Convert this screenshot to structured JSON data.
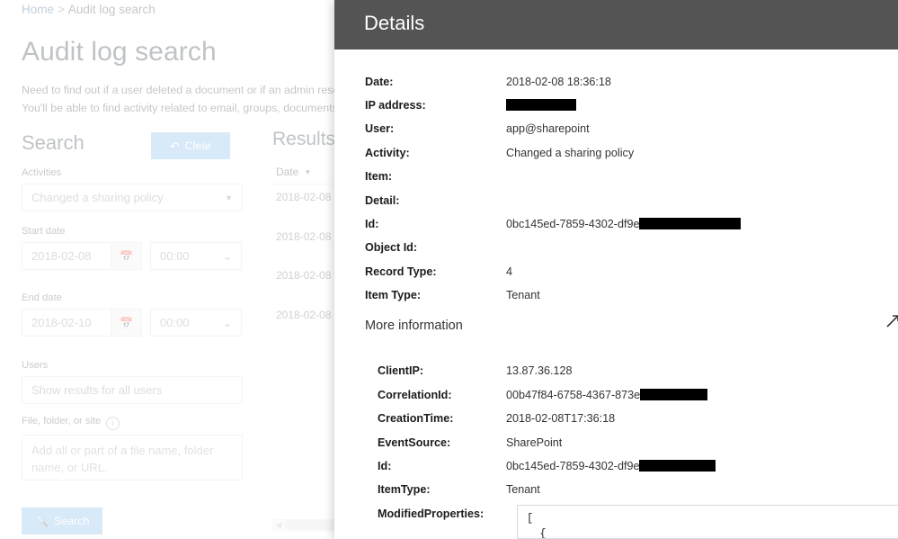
{
  "breadcrumb": {
    "home": "Home",
    "separator": ">",
    "current": "Audit log search"
  },
  "page": {
    "title": "Audit log search",
    "description_line1": "Need to find out if a user deleted a document or if an admin reset s",
    "description_line2": "You'll be able to find activity related to email, groups, documents, ("
  },
  "search_panel": {
    "heading": "Search",
    "clear_button": "Clear",
    "clear_icon": "undo-arrow-icon",
    "search_button": "Search",
    "search_icon": "magnifier-icon",
    "activities_label": "Activities",
    "activities_value": "Changed a sharing policy",
    "start_date_label": "Start date",
    "start_date_value": "2018-02-08",
    "start_time_value": "00:00",
    "end_date_label": "End date",
    "end_date_value": "2018-02-10",
    "end_time_value": "00:00",
    "users_label": "Users",
    "users_placeholder": "Show results for all users",
    "file_label": "File, folder, or site",
    "file_info_icon": "info-icon",
    "file_placeholder": "Add all or part of a file name, folder name, or URL.",
    "calendar_icon": "calendar-icon",
    "dropdown_icon": "chevron-down-icon"
  },
  "results": {
    "heading": "Results",
    "column_header": "Date",
    "sort_icon": "sort-descending-icon",
    "rows": [
      "2018-02-08",
      "2018-02-08",
      "2018-02-08",
      "2018-02-08"
    ]
  },
  "details": {
    "title": "Details",
    "expand_icon": "diagonal-expand-icon",
    "fields": [
      {
        "label": "Date:",
        "value": "2018-02-08 18:36:18",
        "redacted": false
      },
      {
        "label": "IP address:",
        "value": "",
        "redacted": true,
        "redact_width": 78
      },
      {
        "label": "User:",
        "value": "app@sharepoint",
        "redacted": false
      },
      {
        "label": "Activity:",
        "value": "Changed a sharing policy",
        "redacted": false
      },
      {
        "label": "Item:",
        "value": "",
        "redacted": false
      },
      {
        "label": "Detail:",
        "value": "",
        "redacted": false
      },
      {
        "label": "Id:",
        "value": "0bc145ed-7859-4302-df9e",
        "redacted": true,
        "redact_width": 113
      },
      {
        "label": "Object Id:",
        "value": "",
        "redacted": false
      },
      {
        "label": "Record Type:",
        "value": "4",
        "redacted": false
      },
      {
        "label": "Item Type:",
        "value": "Tenant",
        "redacted": false
      }
    ],
    "more_information_label": "More information",
    "more_fields": [
      {
        "label": "ClientIP:",
        "value": "13.87.36.128",
        "redacted": false
      },
      {
        "label": "CorrelationId:",
        "value": "00b47f84-6758-4367-873e",
        "redacted": true,
        "redact_width": 75
      },
      {
        "label": "CreationTime:",
        "value": "2018-02-08T17:36:18",
        "redacted": false
      },
      {
        "label": "EventSource:",
        "value": "SharePoint",
        "redacted": false
      },
      {
        "label": "Id:",
        "value": "0bc145ed-7859-4302-df9e",
        "redacted": true,
        "redact_width": 85
      },
      {
        "label": "ItemType:",
        "value": "Tenant",
        "redacted": false
      },
      {
        "label": "ModifiedProperties:",
        "value": "",
        "redacted": false
      }
    ],
    "modified_properties_text": "[\n  {"
  },
  "colors": {
    "accent_button": "#7fb8e8",
    "panel_header": "#545454",
    "redaction": "#000000",
    "field_border": "#d9dde1"
  }
}
